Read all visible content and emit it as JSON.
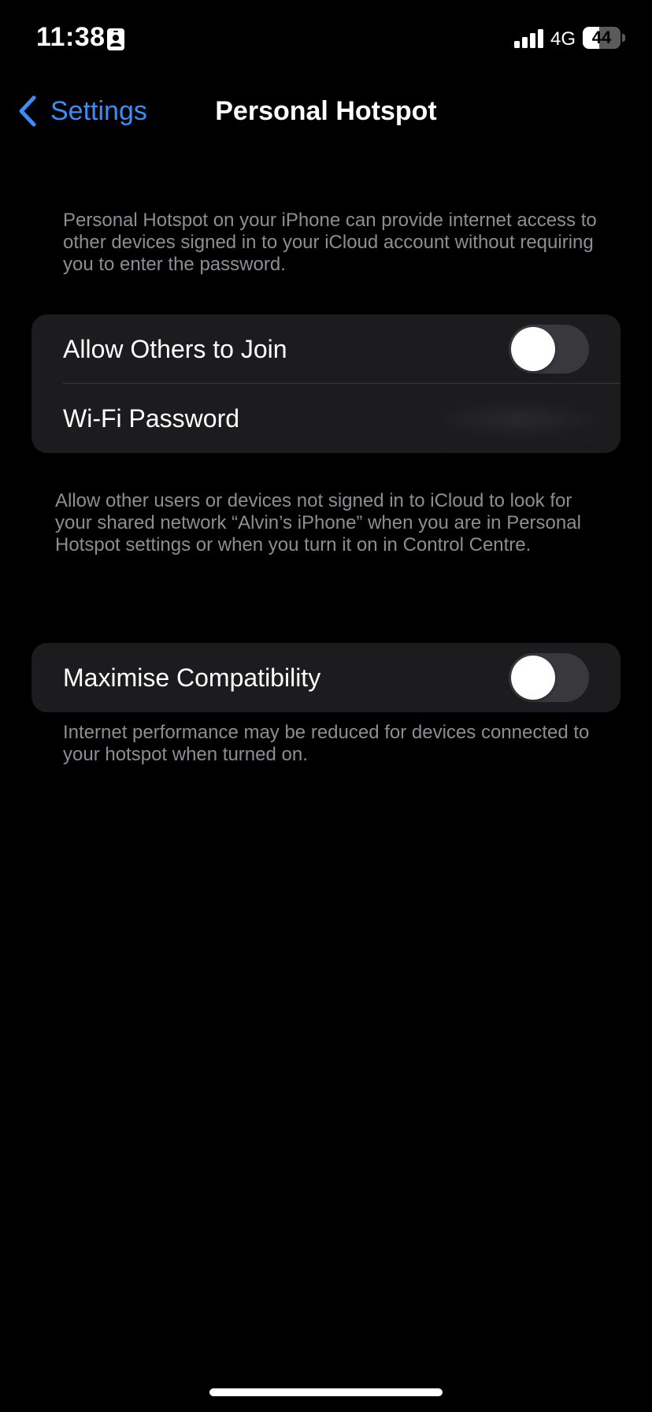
{
  "status_bar": {
    "time": "11:38",
    "network": "4G",
    "battery_level": "44",
    "battery_fraction": 0.44,
    "focus_icon": "person-badge-icon",
    "signal_icon": "cellular-signal-icon"
  },
  "nav": {
    "back_label": "Settings",
    "back_icon": "chevron-left-icon",
    "title": "Personal Hotspot"
  },
  "intro_text": "Personal Hotspot on your iPhone can provide internet access to other devices signed in to your iCloud account without requiring you to enter the password.",
  "group1": {
    "allow_label": "Allow Others to Join",
    "allow_on": false,
    "password_label": "Wi-Fi Password"
  },
  "group1_footer": "Allow other users or devices not signed in to iCloud to look for your shared network “Alvin’s iPhone” when you are in Personal Hotspot settings or when you turn it on in Control Centre.",
  "group2": {
    "compat_label": "Maximise Compatibility",
    "compat_on": false
  },
  "group2_footer": "Internet performance may be reduced for devices connected to your hotspot when turned on.",
  "colors": {
    "background": "#000000",
    "cell": "#1c1c1e",
    "accent": "#3a8ff7",
    "secondary_text": "#8d8d93",
    "toggle_off": "#39393d"
  }
}
